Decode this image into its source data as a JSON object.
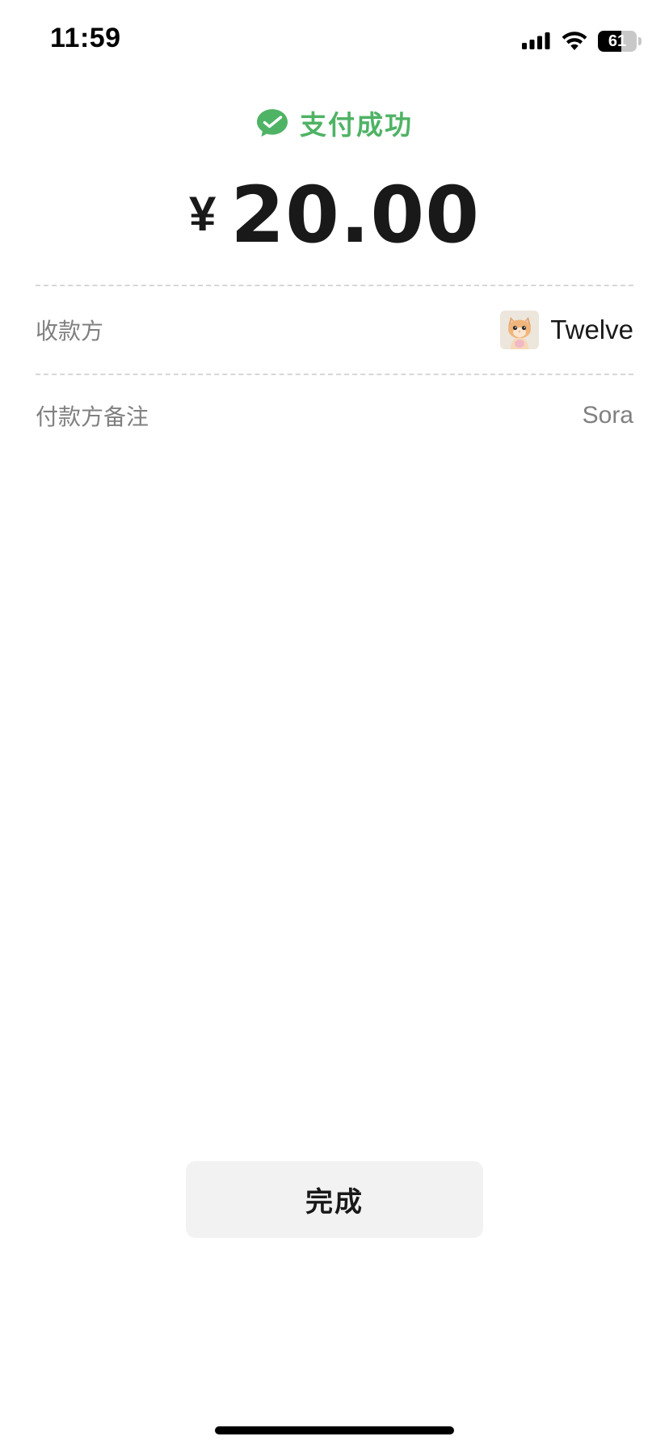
{
  "status_bar": {
    "time": "11:59",
    "battery_level": "61",
    "battery_fraction": 0.61,
    "signal_icon": "cellular-signal-icon",
    "wifi_icon": "wifi-icon"
  },
  "header": {
    "icon": "wechat-pay-check-icon",
    "status_text": "支付成功"
  },
  "amount": {
    "currency_symbol": "¥",
    "value": "20.00"
  },
  "details": {
    "payee_label": "收款方",
    "payee_name": "Twelve",
    "payee_avatar": "cat-avatar",
    "remark_label": "付款方备注",
    "remark_value": "Sora"
  },
  "actions": {
    "done_label": "完成"
  },
  "colors": {
    "success_green": "#4fb365",
    "text_primary": "#191919",
    "text_secondary": "#808080",
    "button_bg": "#f2f2f2",
    "divider": "#d7d7d7"
  }
}
